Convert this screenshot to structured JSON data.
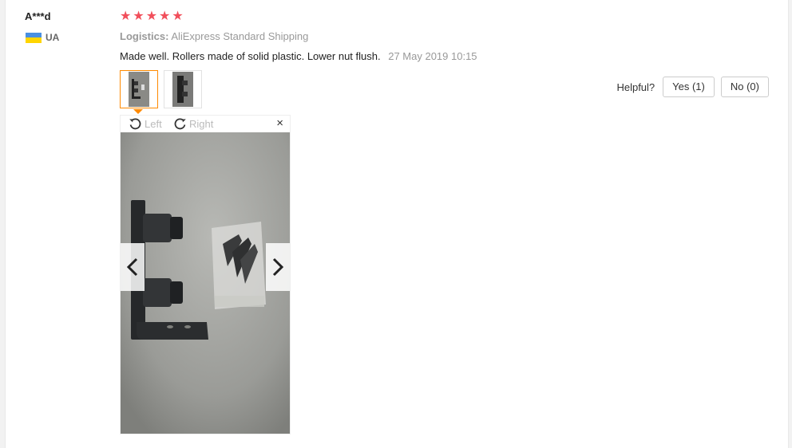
{
  "review": {
    "user": "A***d",
    "country_code": "UA",
    "rating": 5,
    "logistics_label": "Logistics:",
    "logistics_value": "AliExpress Standard Shipping",
    "text": "Made well. Rollers made of solid plastic. Lower nut flush.",
    "date": "27 May 2019 10:15"
  },
  "helpful": {
    "label": "Helpful?",
    "yes": "Yes (1)",
    "no": "No (0)"
  },
  "viewer": {
    "rotate_left": "Left",
    "rotate_right": "Right",
    "close": "×"
  },
  "colors": {
    "star": "#f14f5b",
    "active_thumb_border": "#ff8a00",
    "flag_top": "#4a90e2",
    "flag_bottom": "#ffd500"
  }
}
